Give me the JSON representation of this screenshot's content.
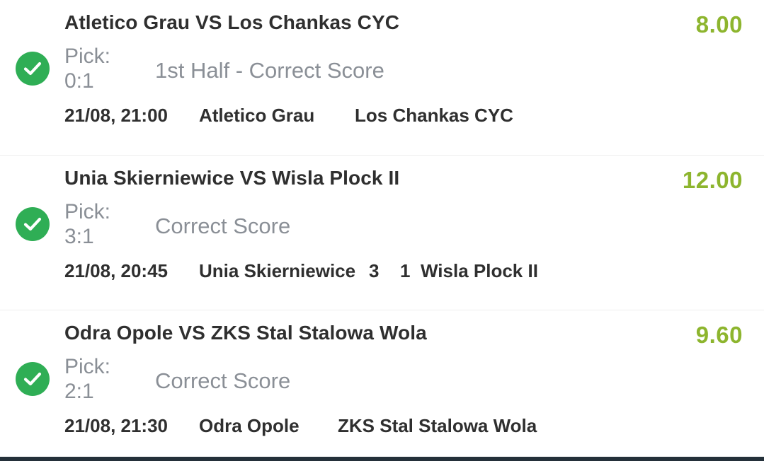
{
  "colors": {
    "odds": "#8db52e",
    "check": "#2fae55",
    "title": "#2f2f2f",
    "muted": "#8a8f96"
  },
  "bets": [
    {
      "title": "Atletico Grau VS Los Chankas CYC",
      "odds": "8.00",
      "pick_label": "Pick:",
      "pick_value": "0:1",
      "market": "1st Half - Correct Score",
      "datetime": "21/08, 21:00",
      "home": "Atletico Grau",
      "home_score": "",
      "away_score": "",
      "away": "Los Chankas CYC",
      "status_icon": "check-circle-icon"
    },
    {
      "title": "Unia Skierniewice VS Wisla Plock II",
      "odds": "12.00",
      "pick_label": "Pick:",
      "pick_value": "3:1",
      "market": "Correct Score",
      "datetime": "21/08, 20:45",
      "home": "Unia Skierniewice",
      "home_score": "3",
      "away_score": "1",
      "away": "Wisla Plock II",
      "status_icon": "check-circle-icon"
    },
    {
      "title": "Odra Opole VS ZKS Stal Stalowa Wola",
      "odds": "9.60",
      "pick_label": "Pick:",
      "pick_value": "2:1",
      "market": "Correct Score",
      "datetime": "21/08, 21:30",
      "home": "Odra Opole",
      "home_score": "",
      "away_score": "",
      "away": "ZKS Stal Stalowa Wola",
      "status_icon": "check-circle-icon"
    }
  ]
}
